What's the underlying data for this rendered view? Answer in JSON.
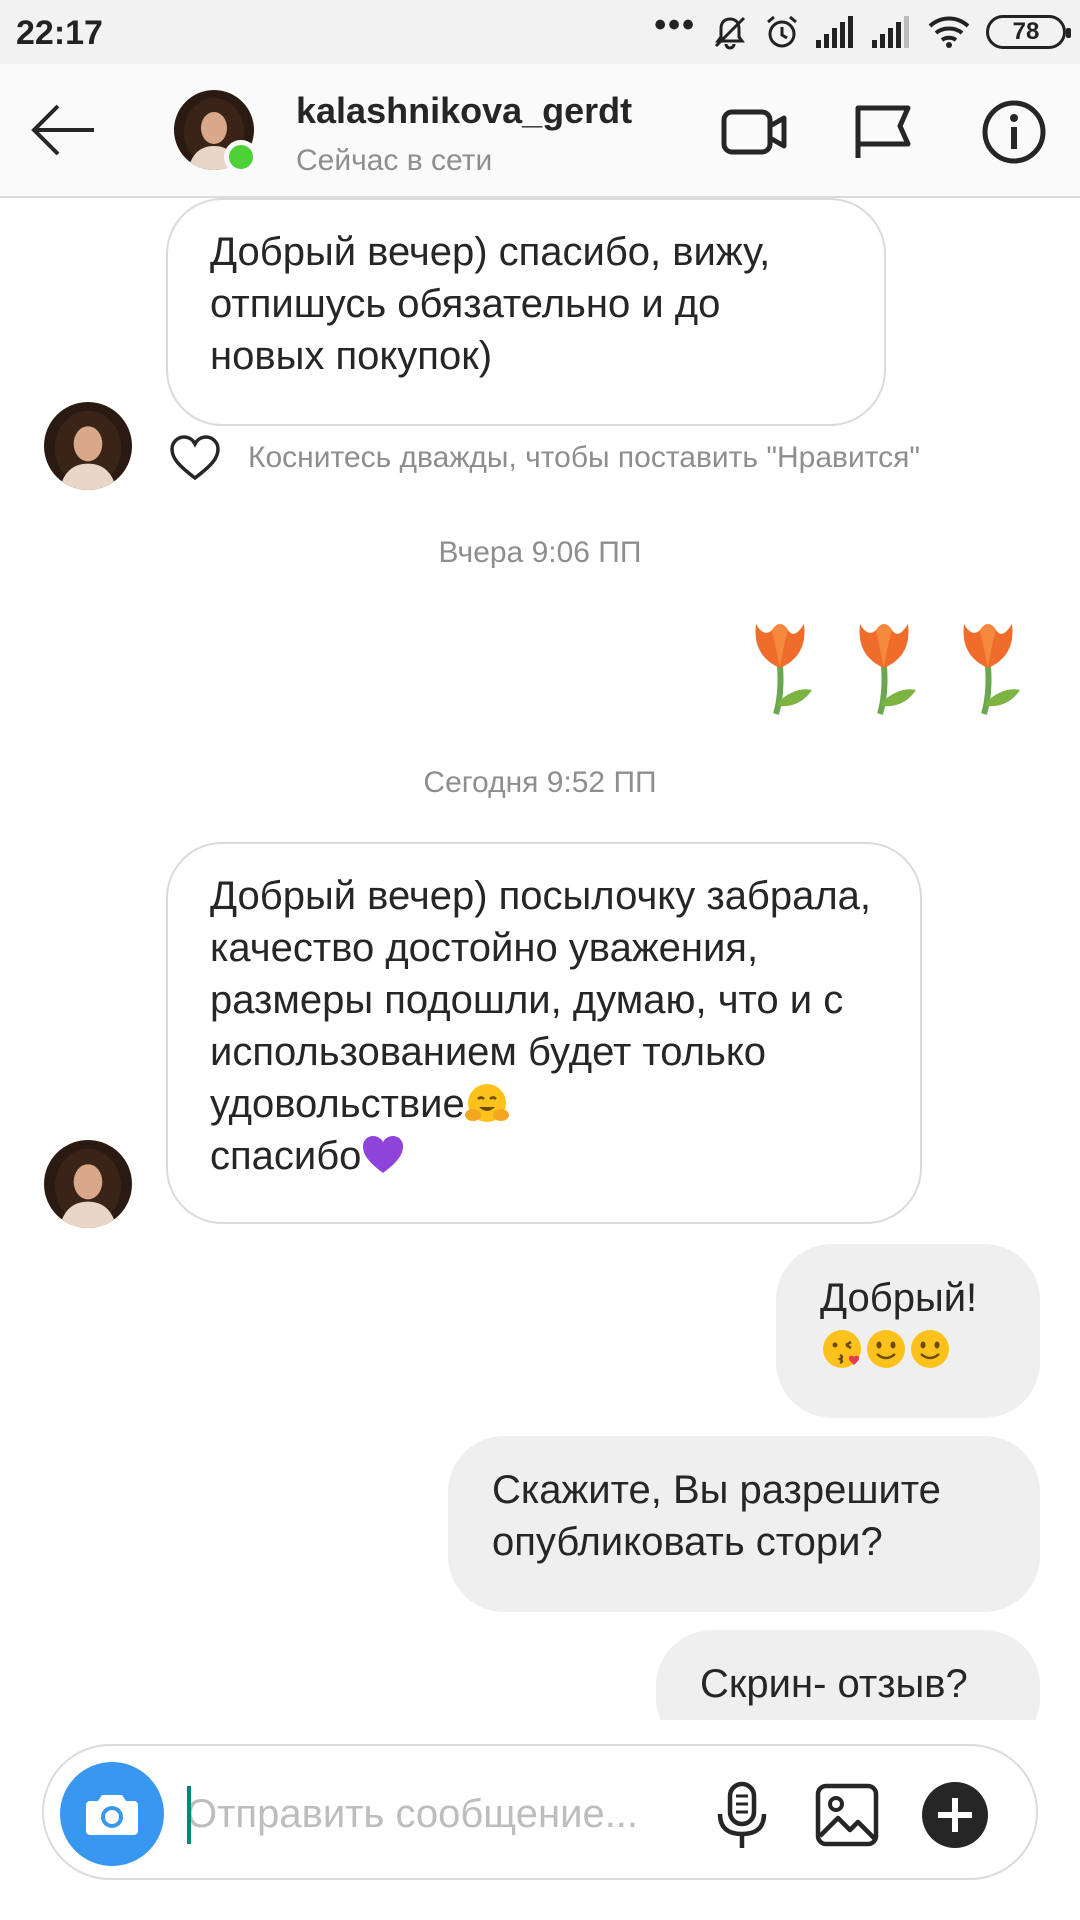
{
  "status_bar": {
    "time": "22:17",
    "battery": "78"
  },
  "header": {
    "username": "kalashnikova_gerdt",
    "status": "Сейчас в сети"
  },
  "messages": {
    "m1": "Добрый вечер) спасибо, вижу, отпишусь обязательно и до новых покупок)",
    "like_hint": "Коснитесь дважды, чтобы поставить \"Нравится\"",
    "ts1": "Вчера 9:06 ПП",
    "ts2": "Сегодня 9:52 ПП",
    "m2_text": "Добрый вечер) посылочку забрала, качество достойно уважения, размеры подошли, думаю, что и с использованием будет только удовольствие",
    "m2_tail": "спасибо",
    "m3": "Добрый!",
    "m4": "Скажите, Вы разрешите опубликовать стори?",
    "m5": "Скрин- отзыв?"
  },
  "composer": {
    "placeholder": "Отправить сообщение..."
  },
  "colors": {
    "accent": "#3897f0",
    "online": "#4cd137",
    "bubble_sent": "#efefef",
    "border": "#dbdbdb",
    "muted": "#8e8e8e"
  },
  "icons": [
    "back-arrow-icon",
    "video-call-icon",
    "flag-icon",
    "info-icon",
    "heart-icon",
    "tulip-emoji",
    "camera-icon",
    "microphone-icon",
    "gallery-icon",
    "plus-icon"
  ]
}
